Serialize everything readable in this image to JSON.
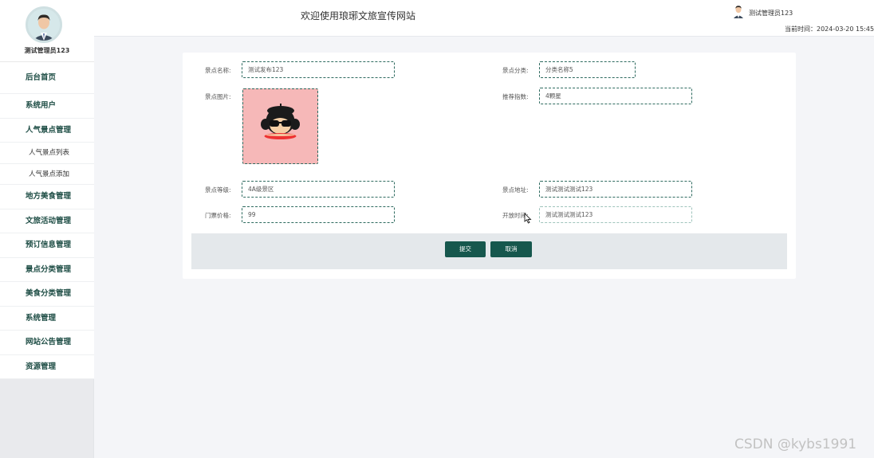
{
  "sidebar": {
    "username": "测试管理员123",
    "menu": [
      {
        "label": "后台首页"
      },
      {
        "label": "系统用户"
      },
      {
        "label": "人气景点管理"
      },
      {
        "label": "人气景点列表"
      },
      {
        "label": "人气景点添加"
      },
      {
        "label": "地方美食管理"
      },
      {
        "label": "文旅活动管理"
      },
      {
        "label": "预订信息管理"
      },
      {
        "label": "景点分类管理"
      },
      {
        "label": "美食分类管理"
      },
      {
        "label": "系统管理"
      },
      {
        "label": "网站公告管理"
      },
      {
        "label": "资源管理"
      }
    ]
  },
  "header": {
    "title": "欢迎使用琅琊文旅宣传网站",
    "user": "测试管理员123",
    "time": "当前时间：2024-03-20 15:45:"
  },
  "form": {
    "name_label": "景点名称:",
    "name_value": "测试发布123",
    "category_label": "景点分类:",
    "category_value": "分类名称5",
    "image_label": "景点图片:",
    "recommend_label": "推荐指数:",
    "recommend_value": "4颗星",
    "level_label": "景点等级:",
    "level_value": "4A级景区",
    "address_label": "景点地址:",
    "address_value": "测试测试测试123",
    "price_label": "门票价格:",
    "price_value": "99",
    "hours_label": "开放时间:",
    "hours_value": "测试测试测试123",
    "submit": "提交",
    "cancel": "取消"
  },
  "watermark": "CSDN @kybs1991",
  "colors": {
    "accent": "#16574d",
    "menu_text": "#1f4e46",
    "image_bg": "#f6b8b8"
  }
}
